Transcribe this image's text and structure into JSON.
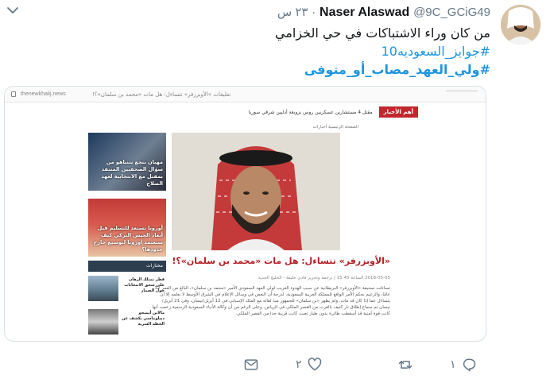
{
  "tweet": {
    "author_name": "Naser Alaswad",
    "author_handle": "@9C_GCiG49",
    "time": "٢٣ س",
    "separator": "·",
    "text": "من كان وراء الاشتباكات في حي الخزامي",
    "hashtags": [
      "#جوايز_السعوديه10",
      "#ولي_العهد_مصاب_أو_متوفى"
    ]
  },
  "card": {
    "browser_url": "thenewkhalij.news",
    "browser_title": "تعليقات «الأوبزرفر» تتساءل: هل مات «محمد بن سلمان»؟!",
    "news_label": "أهم الأخبار",
    "news_ticker": "مقتل 4 مستشارين عسكريين روس بزوبعة أدلبين شرقي سوريا",
    "breadcrumb": "الصفحة الرئيسية  أخبارات",
    "thumb1_caption": "مهبان بنجع نتنياهو من سؤال الصحفيين المنتقد بمقتل مع الانتخابية لعهد الصلاح",
    "thumb2_caption": "أوروبا تستعد للتسليم قبل أنعاد الجيش التركي كيف ستعتمد أوروبا لتوسيع خارج حدودها؟",
    "article_title": "«الأوبزرفر» تتساءل: هل مات «محمد بن سلمان»؟!",
    "meta": "2018-05-05 الساعة 15:45 | ترجمة وتحرير فادي خليفة - الخليج الجديد",
    "body": "تساءلت صحيفة «الأوبزرفر» البريطانية عن سبب الهدوء الغريب لولي العهد السعودي الأمير «محمد بن سلمان»، البالغ من العمر 32 عامًا، والزعيم بحكم الأمر الواقع للمملكة العربية السعودية، لدرجة أن البعض في وسائل الإعلام في الشرق الأوسط لا يعلمه إلا أن يتساءل عما إذا كان قد مات. ولم يظهر «بن سلمان» للجمهور منذ لقائه مع الملك الإسباني في 12 أبريل/نيسان، وفي 21 أبريل/نيسان تم سماع إطلاق نار كثيف بالقرب من القصر الملكي في الرياض. وعلى الرغم من أن وكالة الأنباء السعودية الرسمية زعمت أنها كانت قوة أمنية قد أسقطت طائرة بدون طيار تعبث كانت قريبة جدا من القصر الملكي.",
    "sidebar_title": "مختارات",
    "side_item1": "قطر تمتلك الرهان على سحق الانتخابات حول الصمار",
    "side_item2": "مالاين أيمنجو ديبلوماسي يكشف عن الخطة السرية"
  },
  "actions": {
    "reply_count": "١",
    "retweet_count": "",
    "like_count": "٢",
    "dm_count": ""
  }
}
